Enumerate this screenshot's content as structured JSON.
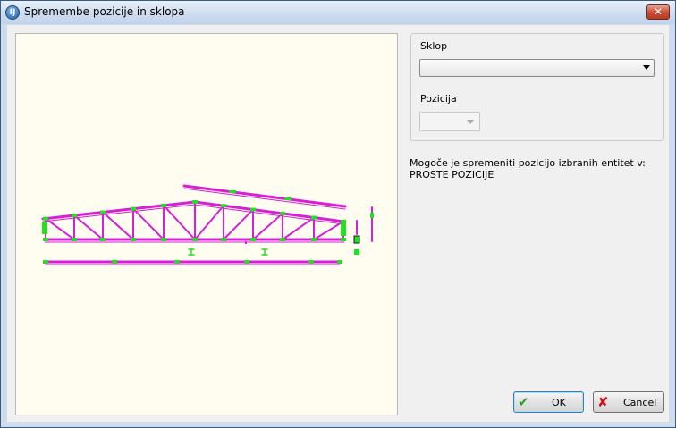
{
  "window": {
    "title": "Spremembe pozicije in sklopa",
    "app_icon_text": "IJ",
    "close_glyph": "✕"
  },
  "form": {
    "sklop_label": "Sklop",
    "sklop_value": "",
    "pozicija_label": "Pozicija",
    "pozicija_value": ""
  },
  "info": {
    "line1": "Mogoče je spremeniti pozicijo izbranih entitet v:",
    "line2": "PROSTE POZICIJE"
  },
  "buttons": {
    "ok_label": "OK",
    "ok_glyph": "✔",
    "cancel_label": "Cancel",
    "cancel_glyph": "✘"
  },
  "colors": {
    "truss_member": "#d61fd6",
    "connection_plate": "#22e022",
    "canvas_bg": "#fffdf0",
    "ok_check": "#2f9e2f",
    "cancel_x": "#d01010"
  }
}
